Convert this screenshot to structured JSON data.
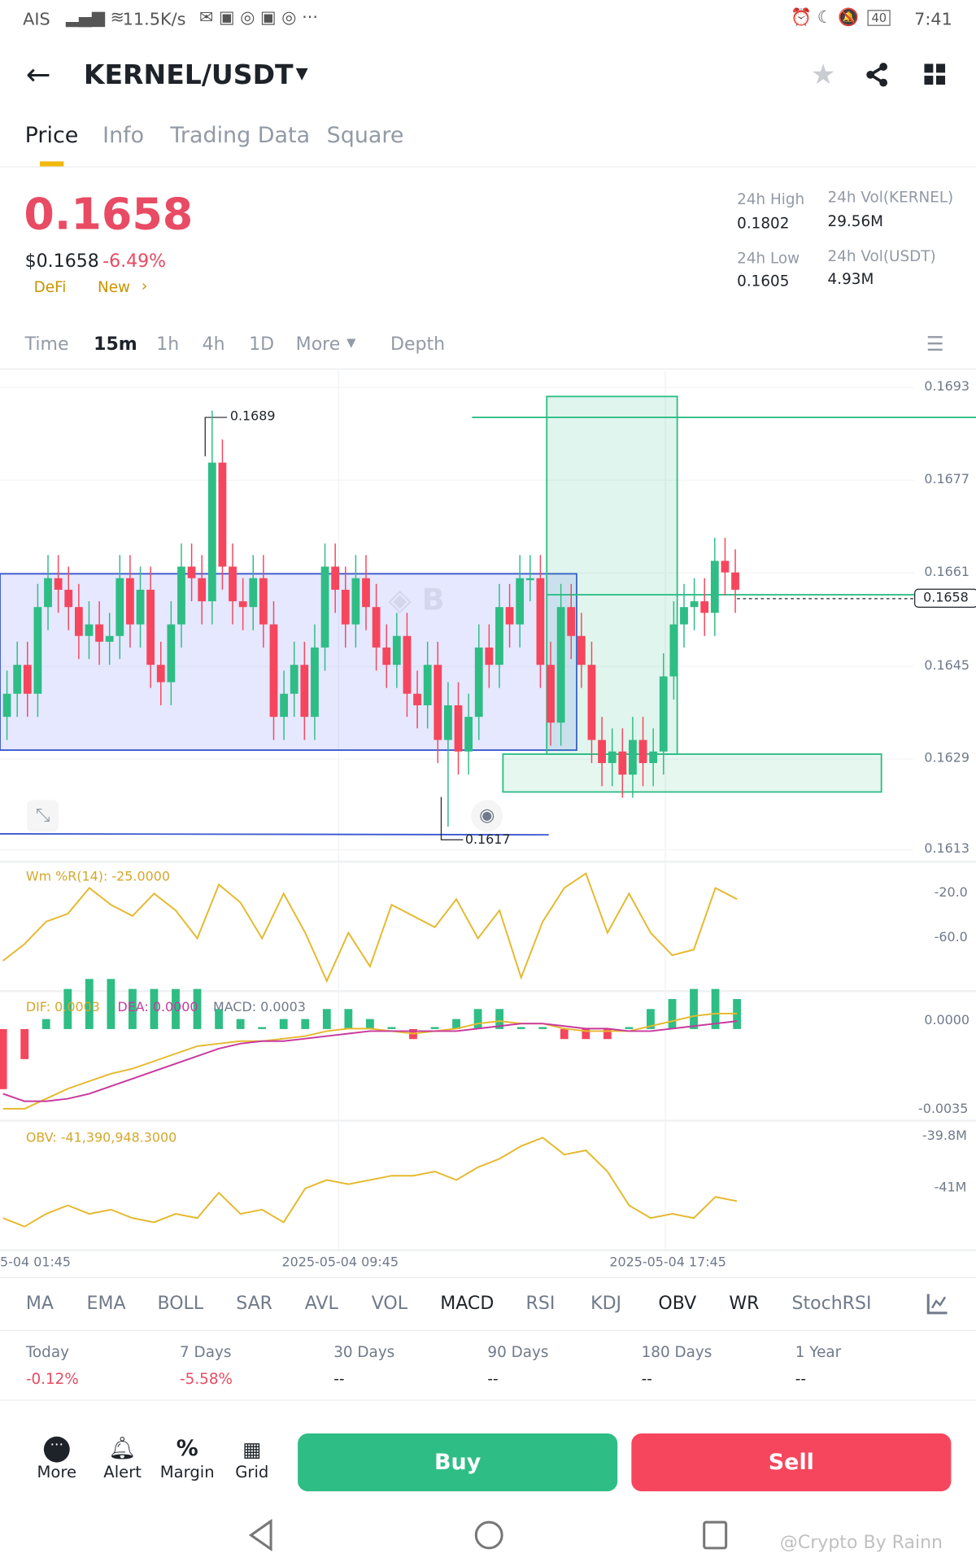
{
  "status_bar": {
    "carrier": "AIS",
    "speed": "11.5K/s",
    "battery": "40",
    "time": "7:41"
  },
  "header": {
    "pair": "KERNEL/USDT"
  },
  "tabs": [
    "Price",
    "Info",
    "Trading Data",
    "Square"
  ],
  "price": {
    "last": "0.1658",
    "usd": "$0.1658",
    "change": "-6.49%",
    "tag1": "DeFi",
    "tag2": "New"
  },
  "stats": {
    "high_label": "24h High",
    "high": "0.1802",
    "low_label": "24h Low",
    "low": "0.1605",
    "vol_base_label": "24h Vol(KERNEL)",
    "vol_base": "29.56M",
    "vol_quote_label": "24h Vol(USDT)",
    "vol_quote": "4.93M"
  },
  "intervals": [
    "Time",
    "15m",
    "1h",
    "4h",
    "1D",
    "More",
    "Depth"
  ],
  "chart_data": {
    "type": "candlestick",
    "price_axis": [
      "0.1693",
      "0.1677",
      "0.1661",
      "0.1645",
      "0.1629",
      "0.1613"
    ],
    "ylim": [
      0.1613,
      0.1693
    ],
    "last_price_label": "0.1658",
    "high_marker": "0.1689",
    "low_marker": "0.1617",
    "time_labels": [
      "5-04 01:45",
      "2025-05-04 09:45",
      "2025-05-04 17:45"
    ],
    "closes": [
      0.164,
      0.1645,
      0.164,
      0.1655,
      0.166,
      0.1658,
      0.1655,
      0.165,
      0.1652,
      0.1649,
      0.165,
      0.166,
      0.1652,
      0.1658,
      0.1645,
      0.1642,
      0.1652,
      0.1662,
      0.166,
      0.1656,
      0.168,
      0.1662,
      0.1656,
      0.1655,
      0.166,
      0.1652,
      0.1636,
      0.164,
      0.1645,
      0.1636,
      0.1648,
      0.1662,
      0.1658,
      0.1652,
      0.166,
      0.1655,
      0.1648,
      0.1645,
      0.165,
      0.164,
      0.1638,
      0.1645,
      0.1632,
      0.1638,
      0.163,
      0.1636,
      0.1648,
      0.1645,
      0.1655,
      0.1652,
      0.166,
      0.166,
      0.1645,
      0.1635,
      0.1655,
      0.165,
      0.1645,
      0.1632,
      0.1628,
      0.163,
      0.1626,
      0.1632,
      0.1628,
      0.163,
      0.1643,
      0.1652,
      0.1655,
      0.1656,
      0.1654,
      0.1663,
      0.1661,
      0.1658
    ],
    "wr": {
      "label": "Wm %R(14): -25.0000",
      "axis": [
        "-20.0",
        "-60.0"
      ],
      "values": [
        -80,
        -65,
        -45,
        -38,
        -15,
        -30,
        -40,
        -20,
        -35,
        -60,
        -12,
        -28,
        -60,
        -20,
        -55,
        -98,
        -55,
        -85,
        -30,
        -40,
        -50,
        -25,
        -60,
        -35,
        -95,
        -45,
        -15,
        -2,
        -55,
        -20,
        -55,
        -75,
        -70,
        -15,
        -25
      ]
    },
    "macd": {
      "dif_label": "DIF: 0.0003",
      "dea_label": "DEA: 0.0000",
      "macd_label": "MACD: 0.0003",
      "axis": [
        "0.0000",
        "-0.0035"
      ],
      "dif": [
        -0.0035,
        -0.0035,
        -0.0031,
        -0.0027,
        -0.0024,
        -0.0021,
        -0.0019,
        -0.0016,
        -0.0013,
        -0.001,
        -0.0009,
        -0.0008,
        -0.0008,
        -0.0007,
        -0.0006,
        -0.0004,
        -0.0003,
        -0.0003,
        -0.0004,
        -0.0005,
        -0.0004,
        -0.0003,
        -0.0001,
        0.0,
        -0.0001,
        -0.0001,
        -0.0003,
        -0.0004,
        -0.0004,
        -0.0004,
        -0.0002,
        0.0,
        0.0002,
        0.0003,
        0.0003
      ],
      "dea": [
        -0.0029,
        -0.0032,
        -0.0032,
        -0.0031,
        -0.0029,
        -0.0026,
        -0.0023,
        -0.002,
        -0.0017,
        -0.0014,
        -0.0011,
        -0.0009,
        -0.0008,
        -0.0008,
        -0.0007,
        -0.0006,
        -0.0005,
        -0.0004,
        -0.0004,
        -0.0004,
        -0.0004,
        -0.0004,
        -0.0003,
        -0.0002,
        -0.0001,
        -0.0001,
        -0.0002,
        -0.0003,
        -0.0003,
        -0.0004,
        -0.0004,
        -0.0003,
        -0.0002,
        -0.0001,
        0.0
      ]
    },
    "obv": {
      "label": "OBV: -41,390,948.3000",
      "axis": [
        "-39.8M",
        "-41M"
      ],
      "values": [
        -41.7,
        -41.9,
        -41.6,
        -41.4,
        -41.6,
        -41.5,
        -41.7,
        -41.8,
        -41.6,
        -41.7,
        -41.1,
        -41.6,
        -41.5,
        -41.8,
        -41.0,
        -40.8,
        -40.9,
        -40.8,
        -40.7,
        -40.7,
        -40.6,
        -40.8,
        -40.5,
        -40.3,
        -40.0,
        -39.8,
        -40.2,
        -40.1,
        -40.6,
        -41.4,
        -41.7,
        -41.6,
        -41.7,
        -41.2,
        -41.3
      ]
    }
  },
  "indicators": [
    {
      "label": "MA",
      "on": false
    },
    {
      "label": "EMA",
      "on": false
    },
    {
      "label": "BOLL",
      "on": false
    },
    {
      "label": "SAR",
      "on": false
    },
    {
      "label": "AVL",
      "on": false
    },
    {
      "label": "VOL",
      "on": false
    },
    {
      "label": "MACD",
      "on": true
    },
    {
      "label": "RSI",
      "on": false
    },
    {
      "label": "KDJ",
      "on": false
    },
    {
      "label": "OBV",
      "on": true
    },
    {
      "label": "WR",
      "on": true
    },
    {
      "label": "StochRSI",
      "on": false
    }
  ],
  "performance": [
    {
      "label": "Today",
      "value": "-0.12%"
    },
    {
      "label": "7 Days",
      "value": "-5.58%"
    },
    {
      "label": "30 Days",
      "value": "--"
    },
    {
      "label": "90 Days",
      "value": "--"
    },
    {
      "label": "180 Days",
      "value": "--"
    },
    {
      "label": "1 Year",
      "value": "--"
    }
  ],
  "bottom": {
    "more": "More",
    "alert": "Alert",
    "margin": "Margin",
    "grid": "Grid",
    "buy": "Buy",
    "sell": "Sell"
  },
  "watermark": "@Crypto By Rainn",
  "colors": {
    "up": "#2ebd85",
    "down": "#f6465d",
    "accent": "#f0b90b"
  }
}
